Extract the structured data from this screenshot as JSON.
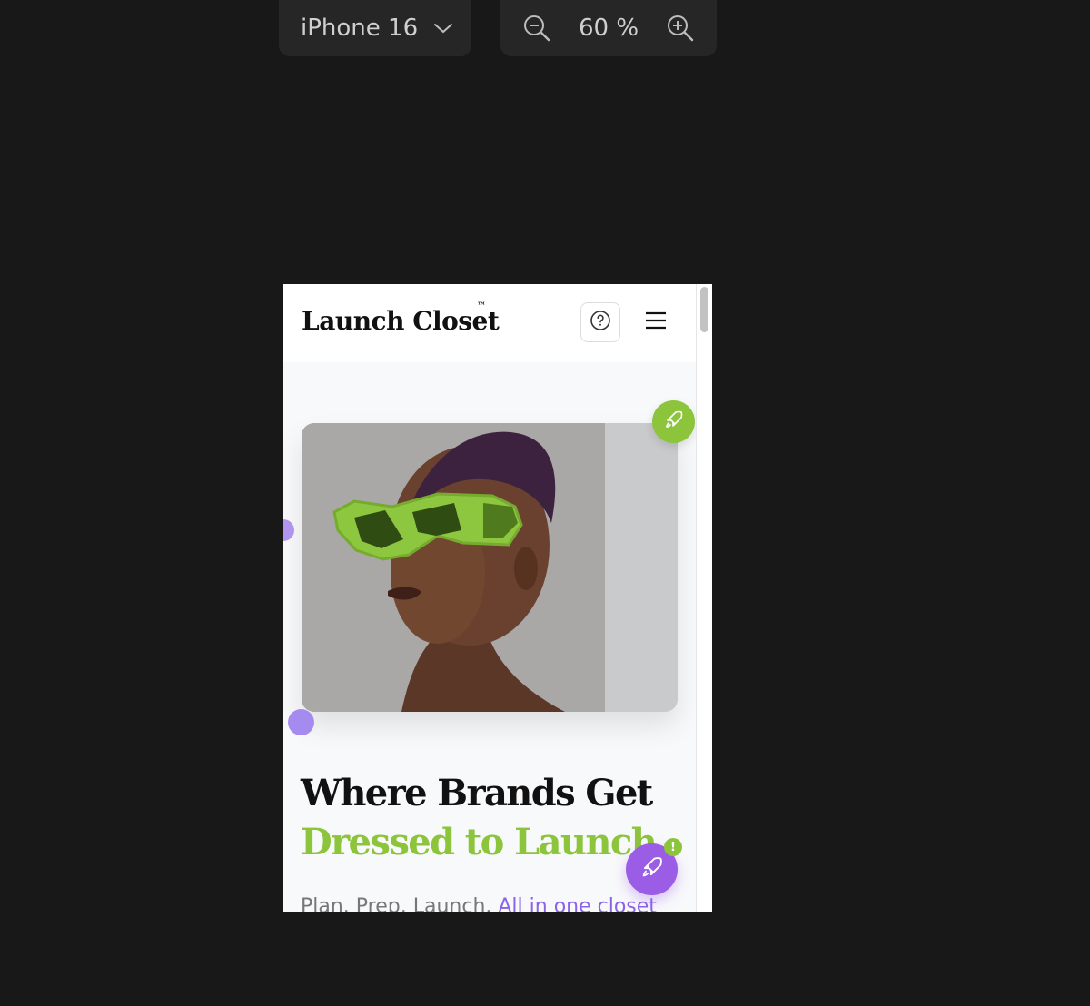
{
  "toolbar": {
    "device_label": "iPhone 16",
    "zoom_level": "60 %",
    "icons": [
      "chevron-down-icon",
      "zoom-out-icon",
      "zoom-in-icon"
    ]
  },
  "site": {
    "brand": "Launch Closet",
    "trademark": "™",
    "header_icons": [
      "help-icon",
      "hamburger-menu-icon"
    ]
  },
  "hero": {
    "title_line1": "Where Brands Get",
    "title_line2": "Dressed to Launch",
    "subtitle_plain": "Plan. Prep. Launch.",
    "subtitle_link": "All in one closet",
    "image_alt": "Model wearing green sunglasses",
    "fab_badge": "!"
  },
  "colors": {
    "accent_green": "#8cc43c",
    "accent_purple": "#9b5de5",
    "canvas_bg": "#181818"
  }
}
